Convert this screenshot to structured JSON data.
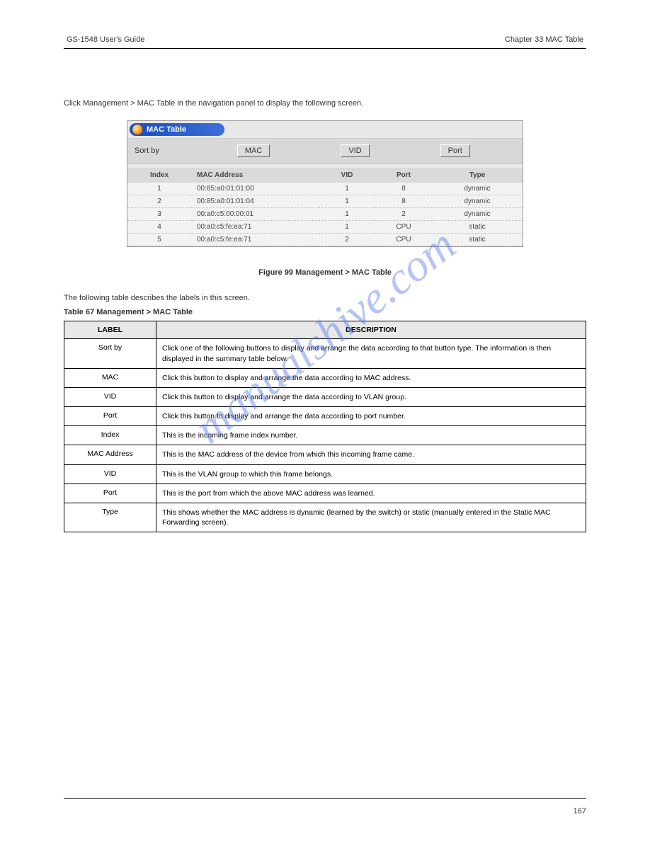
{
  "header": {
    "left": "GS-1548 User's Guide",
    "right": "Chapter 33 MAC Table"
  },
  "intro": "Click Management > MAC Table in the navigation panel to display the following screen.",
  "screenshot": {
    "title": "MAC Table",
    "sort_label": "Sort by",
    "btn_mac": "MAC",
    "btn_vid": "VID",
    "btn_port": "Port",
    "headers": {
      "index": "Index",
      "mac": "MAC Address",
      "vid": "VID",
      "port": "Port",
      "type": "Type"
    },
    "rows": [
      {
        "index": "1",
        "mac": "00:85:a0:01:01:00",
        "vid": "1",
        "port": "8",
        "type": "dynamic"
      },
      {
        "index": "2",
        "mac": "00:85:a0:01:01:04",
        "vid": "1",
        "port": "8",
        "type": "dynamic"
      },
      {
        "index": "3",
        "mac": "00:a0:c5:00:00:01",
        "vid": "1",
        "port": "2",
        "type": "dynamic"
      },
      {
        "index": "4",
        "mac": "00:a0:c5:fe:ea:71",
        "vid": "1",
        "port": "CPU",
        "type": "static"
      },
      {
        "index": "5",
        "mac": "00:a0:c5:fe:ea:71",
        "vid": "2",
        "port": "CPU",
        "type": "static"
      }
    ]
  },
  "figure_caption": "Figure 99   Management > MAC Table",
  "table_intro": "The following table describes the labels in this screen.",
  "table_caption": "Table 67   Management > MAC Table",
  "label_col": "LABEL",
  "desc_col": "DESCRIPTION",
  "desc_rows": [
    {
      "label": "Sort by",
      "desc": "Click one of the following buttons to display and arrange the data according to that button type. The information is then displayed in the summary table below."
    },
    {
      "label": "MAC",
      "desc": "Click this button to display and arrange the data according to MAC address."
    },
    {
      "label": "VID",
      "desc": "Click this button to display and arrange the data according to VLAN group."
    },
    {
      "label": "Port",
      "desc": "Click this button to display and arrange the data according to port number."
    },
    {
      "label": "Index",
      "desc": "This is the incoming frame index number."
    },
    {
      "label": "MAC Address",
      "desc": "This is the MAC address of the device from which this incoming frame came."
    },
    {
      "label": "VID",
      "desc": "This is the VLAN group to which this frame belongs."
    },
    {
      "label": "Port",
      "desc": "This is the port from which the above MAC address was learned."
    },
    {
      "label": "Type",
      "desc": "This shows whether the MAC address is dynamic (learned by the switch) or static (manually entered in the Static MAC Forwarding screen)."
    }
  ],
  "page_number": "167",
  "watermark": "manualshive.com"
}
